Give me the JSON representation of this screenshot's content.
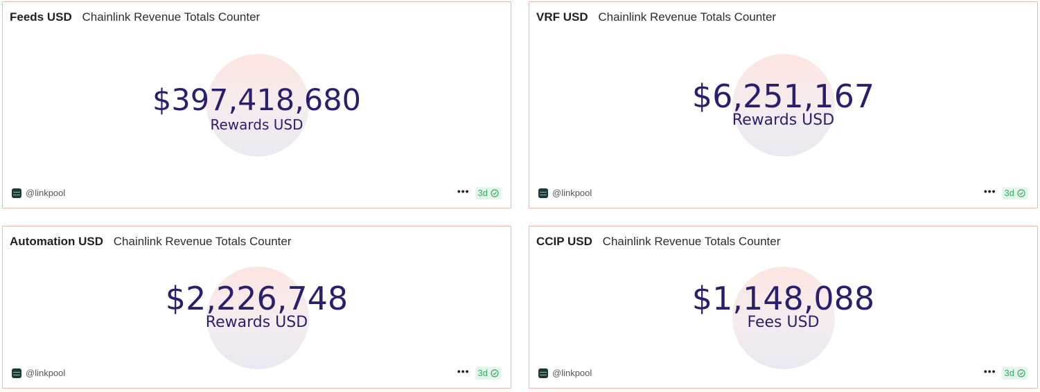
{
  "cards": [
    {
      "name": "Feeds USD",
      "subtitle": "Chainlink Revenue Totals Counter",
      "value": "$397,418,680",
      "unit": "Rewards USD",
      "owner": "@linkpool",
      "freshness": "3d"
    },
    {
      "name": "VRF USD",
      "subtitle": "Chainlink Revenue Totals Counter",
      "value": "$6,251,167",
      "unit": "Rewards USD",
      "owner": "@linkpool",
      "freshness": "3d"
    },
    {
      "name": "Automation USD",
      "subtitle": "Chainlink Revenue Totals Counter",
      "value": "$2,226,748",
      "unit": "Rewards USD",
      "owner": "@linkpool",
      "freshness": "3d"
    },
    {
      "name": "CCIP USD",
      "subtitle": "Chainlink Revenue Totals Counter",
      "value": "$1,148,088",
      "unit": "Fees USD",
      "owner": "@linkpool",
      "freshness": "3d"
    }
  ],
  "icons": {
    "avatar": "linkpool-avatar-icon",
    "more": "more-dots-icon",
    "status": "check-circle-icon"
  },
  "colors": {
    "value_text": "#2a1e6e",
    "card_border": "#f0b8a8",
    "badge_bg": "#e4f6ea",
    "badge_text": "#3aa866"
  }
}
